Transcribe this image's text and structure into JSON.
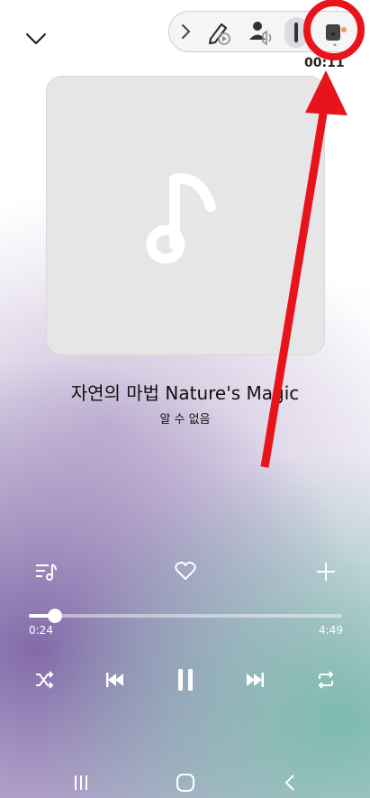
{
  "track": {
    "title": "자연의 마법 Nature's Magic",
    "artist": "알 수 없음"
  },
  "recording": {
    "timer": "00:11"
  },
  "playback": {
    "elapsed": "0:24",
    "duration": "4:49",
    "progress": 0.083
  },
  "colors": {
    "annotation": "#e8141b",
    "accent": "#ffffff",
    "album_bg": "#e6e6e6"
  }
}
